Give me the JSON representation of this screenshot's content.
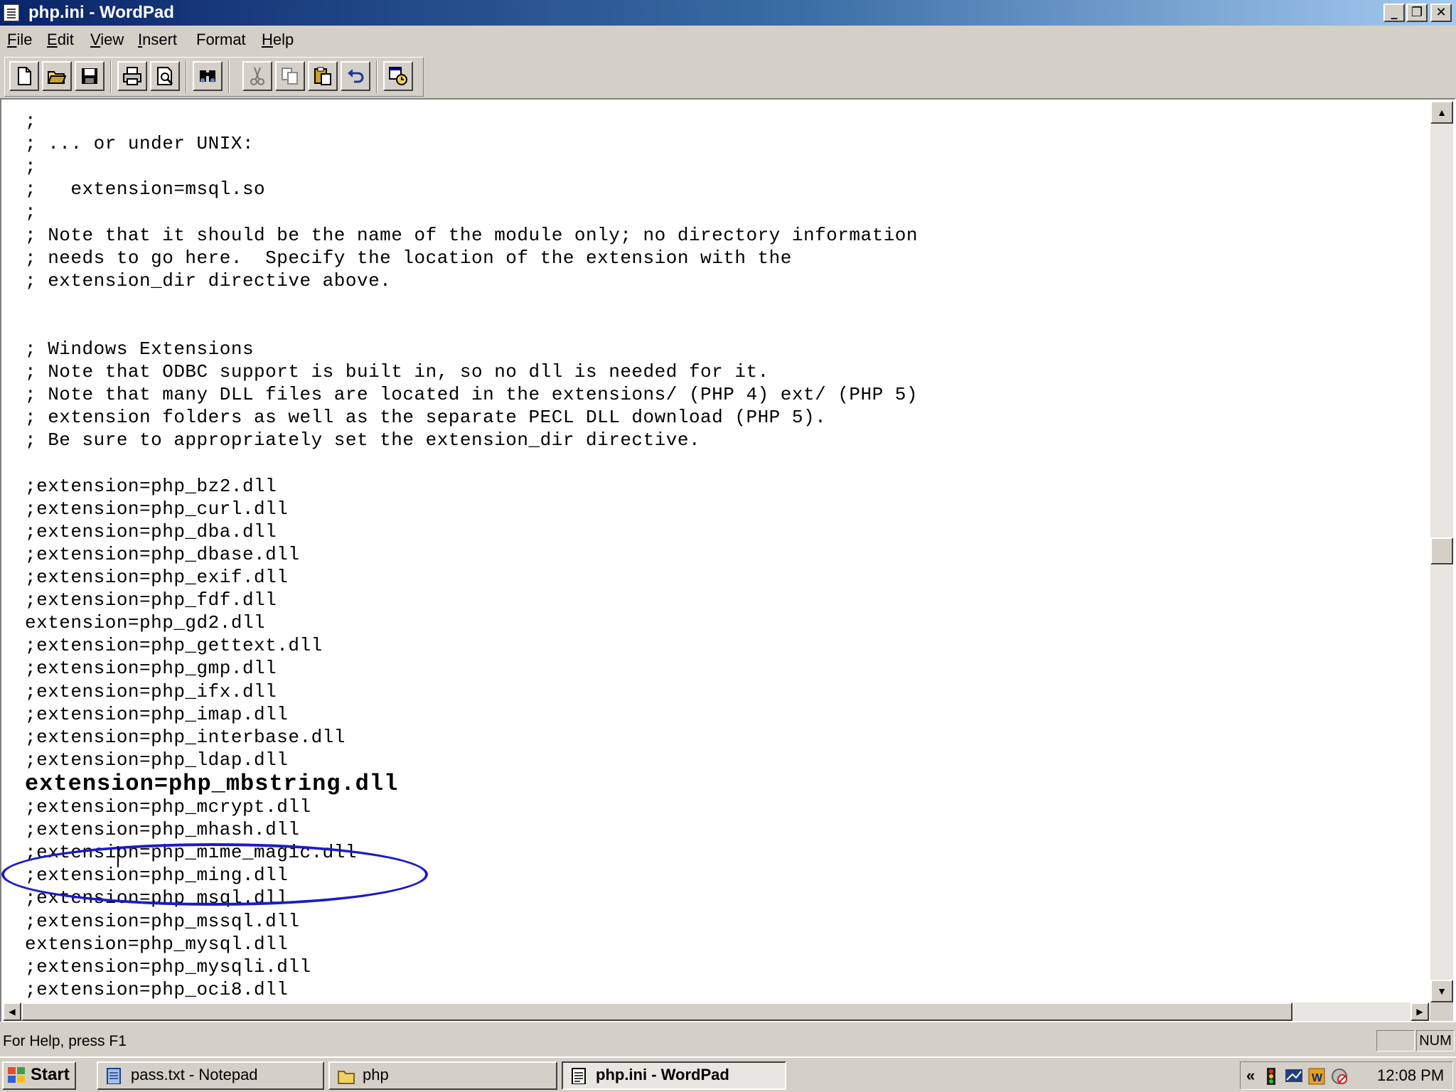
{
  "window": {
    "title": "php.ini - WordPad",
    "minimize_glyph": "_",
    "maximize_glyph": "❐",
    "close_glyph": "✕"
  },
  "menu": {
    "items": [
      {
        "underline": "F",
        "rest": "ile"
      },
      {
        "underline": "E",
        "rest": "dit"
      },
      {
        "underline": "V",
        "rest": "iew"
      },
      {
        "underline": "I",
        "rest": "nsert"
      },
      {
        "underline": "",
        "rest": "Format",
        "pre": "F",
        "label": "Format"
      },
      {
        "underline": "H",
        "rest": "elp"
      }
    ]
  },
  "toolbar": {
    "tools": [
      "new-icon",
      "open-icon",
      "save-icon",
      "print-icon",
      "print-preview-icon",
      "find-icon",
      "cut-icon",
      "copy-icon",
      "paste-icon",
      "undo-icon",
      "insert-datetime-icon"
    ]
  },
  "document": {
    "lines": [
      ";",
      "; ... or under UNIX:",
      ";",
      ";   extension=msql.so",
      ";",
      "; Note that it should be the name of the module only; no directory information",
      "; needs to go here.  Specify the location of the extension with the",
      "; extension_dir directive above.",
      "",
      "",
      "; Windows Extensions",
      "; Note that ODBC support is built in, so no dll is needed for it.",
      "; Note that many DLL files are located in the extensions/ (PHP 4) ext/ (PHP 5)",
      "; extension folders as well as the separate PECL DLL download (PHP 5).",
      "; Be sure to appropriately set the extension_dir directive.",
      "",
      ";extension=php_bz2.dll",
      ";extension=php_curl.dll",
      ";extension=php_dba.dll",
      ";extension=php_dbase.dll",
      ";extension=php_exif.dll",
      ";extension=php_fdf.dll",
      "extension=php_gd2.dll",
      ";extension=php_gettext.dll",
      ";extension=php_gmp.dll",
      ";extension=php_ifx.dll",
      ";extension=php_imap.dll",
      ";extension=php_interbase.dll",
      ";extension=php_ldap.dll",
      "extension=php_mbstring.dll",
      ";extension=php_mcrypt.dll",
      ";extension=php_mhash.dll",
      ";extension=php_mime_magic.dll",
      ";extension=php_ming.dll",
      ";extension=php_msql.dll",
      ";extension=php_mssql.dll",
      "extension=php_mysql.dll",
      ";extension=php_mysqli.dll",
      ";extension=php_oci8.dll"
    ],
    "highlighted_line": "extension=php_mbstring.dll",
    "highlight_color": "#1b1bc8"
  },
  "scrollbars": {
    "up_glyph": "▲",
    "down_glyph": "▼",
    "left_glyph": "◀",
    "right_glyph": "▶"
  },
  "statusbar": {
    "help_text": "For Help, press F1",
    "indicator_blank": "",
    "indicator_num": "NUM"
  },
  "taskbar": {
    "start_label": "Start",
    "tasks": [
      {
        "label": "pass.txt - Notepad",
        "icon": "notepad-icon",
        "active": false
      },
      {
        "label": "php",
        "icon": "folder-icon",
        "active": false
      },
      {
        "label": "php.ini - WordPad",
        "icon": "wordpad-icon",
        "active": true
      }
    ],
    "tray_chevron": "«",
    "clock": "12:08 PM"
  },
  "colors": {
    "titlebar_start": "#0a246a",
    "titlebar_end": "#a6caf0",
    "face": "#d4d0c8"
  }
}
